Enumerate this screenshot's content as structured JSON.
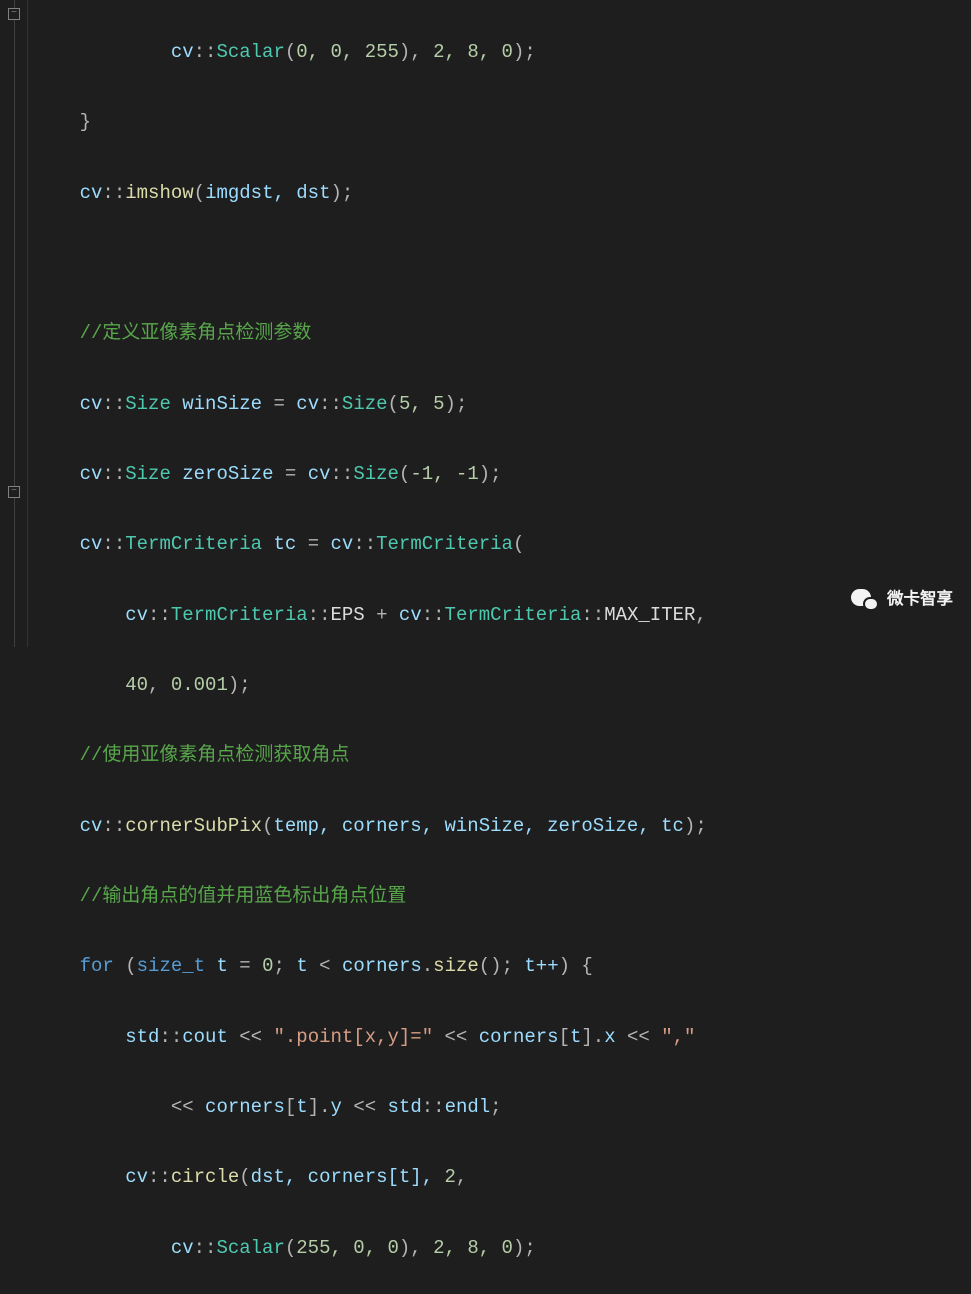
{
  "code": {
    "l1": {
      "scalar": "Scalar",
      "args": "0, 0, 255",
      "tail": "2, 8, 0"
    },
    "l3": {
      "func": "imshow",
      "args": "imgdst, dst"
    },
    "l5": {
      "comment": "//定义亚像素角点检测参数"
    },
    "l6": {
      "type": "Size",
      "var": "winSize",
      "ctor": "Size",
      "args": "5, 5"
    },
    "l7": {
      "type": "Size",
      "var": "zeroSize",
      "ctor": "Size",
      "args": "-1, -1"
    },
    "l8": {
      "type": "TermCriteria",
      "var": "tc",
      "ctor": "TermCriteria"
    },
    "l9": {
      "tc1": "TermCriteria",
      "eps": "EPS",
      "tc2": "TermCriteria",
      "mi": "MAX_ITER"
    },
    "l10": {
      "n1": "40",
      "n2": "0.001"
    },
    "l11": {
      "comment": "//使用亚像素角点检测获取角点"
    },
    "l12": {
      "func": "cornerSubPix",
      "args": "temp, corners, winSize, zeroSize, tc"
    },
    "l13": {
      "comment": "//输出角点的值并用蓝色标出角点位置"
    },
    "l14": {
      "kw": "for",
      "type": "size_t",
      "v": "t",
      "zero": "0",
      "cond": "corners",
      "sz": "size",
      "inc": "t++"
    },
    "l15": {
      "cout": "cout",
      "s1": "\".point[x,y]=\"",
      "c": "corners",
      "t": "t",
      "x": "x",
      "s2": "\",\""
    },
    "l16": {
      "c": "corners",
      "t": "t",
      "y": "y",
      "endl": "endl"
    },
    "l17": {
      "func": "circle",
      "args": "dst, corners[t], ",
      "two": "2"
    },
    "l18": {
      "scalar": "Scalar",
      "args": "255, 0, 0",
      "tail": "2, 8, 0"
    }
  },
  "watermark": {
    "text": "微卡智享"
  }
}
